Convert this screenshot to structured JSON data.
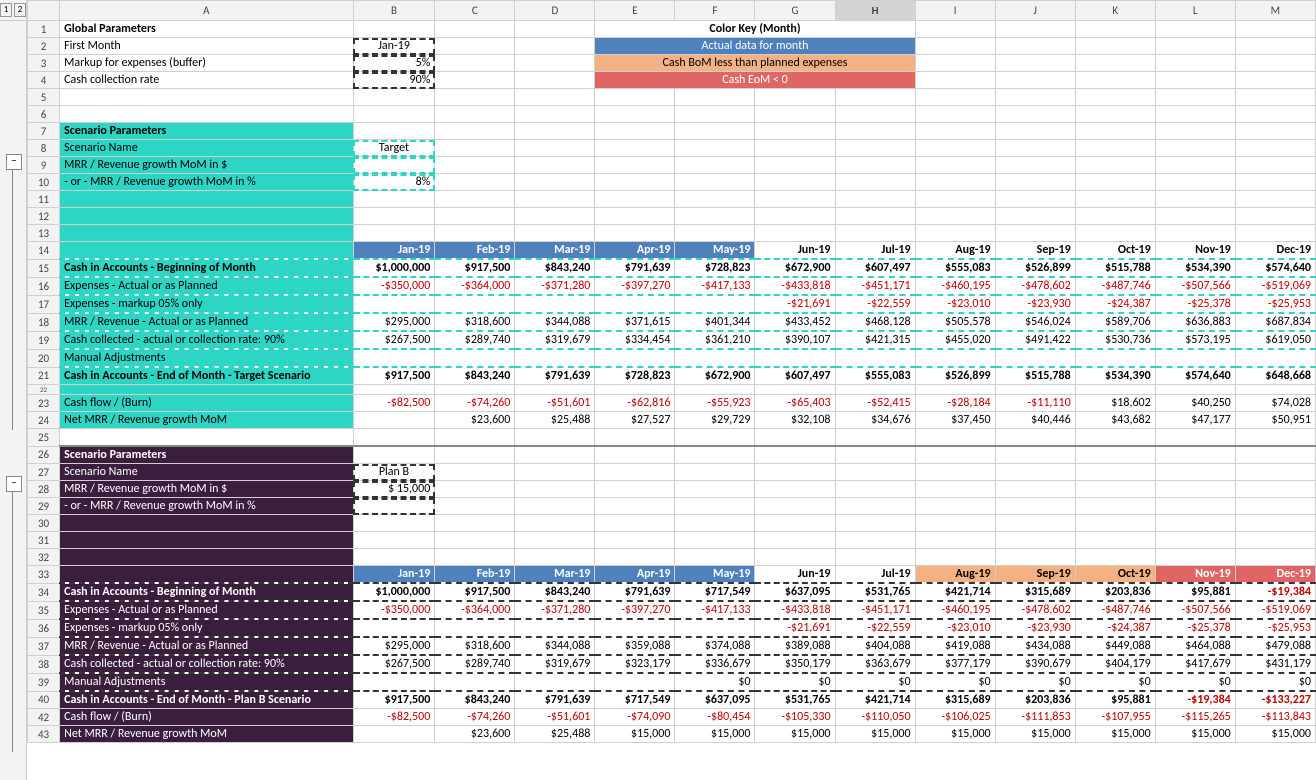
{
  "outlineLevels": [
    "1",
    "2"
  ],
  "colHeaders": [
    "A",
    "B",
    "C",
    "D",
    "E",
    "F",
    "G",
    "H",
    "I",
    "J",
    "K",
    "L",
    "M"
  ],
  "selectedCol": "H",
  "rowsVisible": [
    "1",
    "2",
    "3",
    "4",
    "5",
    "6",
    "7",
    "8",
    "9",
    "10",
    "11",
    "12",
    "13",
    "14",
    "15",
    "16",
    "17",
    "18",
    "19",
    "20",
    "21",
    "22",
    "23",
    "24",
    "25",
    "26",
    "27",
    "28",
    "29",
    "30",
    "31",
    "32",
    "33",
    "34",
    "35",
    "36",
    "37",
    "38",
    "39",
    "40",
    "42",
    "43"
  ],
  "global": {
    "title": "Global Parameters",
    "firstMonthLabel": "First Month",
    "firstMonth": "Jan-19",
    "markupLabel": "Markup for expenses (buffer)",
    "markup": "5%",
    "collectionLabel": "Cash collection rate",
    "collection": "90%"
  },
  "colorKey": {
    "title": "Color Key (Month)",
    "blue": "Actual data for month",
    "orange": "Cash BoM less than planned expenses",
    "red": "Cash EoM < 0"
  },
  "months": [
    "Jan-19",
    "Feb-19",
    "Mar-19",
    "Apr-19",
    "May-19",
    "Jun-19",
    "Jul-19",
    "Aug-19",
    "Sep-19",
    "Oct-19",
    "Nov-19",
    "Dec-19"
  ],
  "scenario1": {
    "paramTitle": "Scenario Parameters",
    "nameLabel": "Scenario Name",
    "name": "Target",
    "growthDollarLabel": "MRR / Revenue growth MoM in $",
    "growthDollar": "",
    "growthPctLabel": "- or - MRR / Revenue growth MoM in %",
    "growthPct": "8%",
    "headerClasses": [
      "hdr-blue",
      "hdr-blue",
      "hdr-blue",
      "hdr-blue",
      "hdr-blue",
      "",
      "",
      "",
      "",
      "",
      "",
      ""
    ],
    "rows": {
      "bomLabel": "Cash in Accounts - Beginning of Month",
      "bom": [
        "$1,000,000",
        "$917,500",
        "$843,240",
        "$791,639",
        "$728,823",
        "$672,900",
        "$607,497",
        "$555,083",
        "$526,899",
        "$515,788",
        "$534,390",
        "$574,640"
      ],
      "expLabel": "Expenses - Actual or as Planned",
      "exp": [
        "-$350,000",
        "-$364,000",
        "-$371,280",
        "-$397,270",
        "-$417,133",
        "-$433,818",
        "-$451,171",
        "-$460,195",
        "-$478,602",
        "-$487,746",
        "-$507,566",
        "-$519,069"
      ],
      "expMkLabel": "Expenses - markup 05% only",
      "expMk": [
        "",
        "",
        "",
        "",
        "",
        "-$21,691",
        "-$22,559",
        "-$23,010",
        "-$23,930",
        "-$24,387",
        "-$25,378",
        "-$25,953"
      ],
      "revLabel": "MRR / Revenue - Actual or as Planned",
      "rev": [
        "$295,000",
        "$318,600",
        "$344,088",
        "$371,615",
        "$401,344",
        "$433,452",
        "$468,128",
        "$505,578",
        "$546,024",
        "$589,706",
        "$636,883",
        "$687,834"
      ],
      "collLabel": "Cash collected - actual or collection rate: 90%",
      "coll": [
        "$267,500",
        "$289,740",
        "$319,679",
        "$334,454",
        "$361,210",
        "$390,107",
        "$421,315",
        "$455,020",
        "$491,422",
        "$530,736",
        "$573,195",
        "$619,050"
      ],
      "manLabel": "Manual Adjustments",
      "man": [
        "",
        "",
        "",
        "",
        "",
        "",
        "",
        "",
        "",
        "",
        "",
        ""
      ],
      "eomLabel": "Cash in Accounts - End of Month - Target Scenario",
      "eom": [
        "$917,500",
        "$843,240",
        "$791,639",
        "$728,823",
        "$672,900",
        "$607,497",
        "$555,083",
        "$526,899",
        "$515,788",
        "$534,390",
        "$574,640",
        "$648,668"
      ],
      "burnLabel": "Cash flow / (Burn)",
      "burn": [
        "-$82,500",
        "-$74,260",
        "-$51,601",
        "-$62,816",
        "-$55,923",
        "-$65,403",
        "-$52,415",
        "-$28,184",
        "-$11,110",
        "$18,602",
        "$40,250",
        "$74,028"
      ],
      "netLabel": "Net MRR / Revenue growth MoM",
      "net": [
        "",
        "$23,600",
        "$25,488",
        "$27,527",
        "$29,729",
        "$32,108",
        "$34,676",
        "$37,450",
        "$40,446",
        "$43,682",
        "$47,177",
        "$50,951"
      ]
    }
  },
  "scenario2": {
    "paramTitle": "Scenario Parameters",
    "nameLabel": "Scenario Name",
    "name": "Plan B",
    "growthDollarLabel": "MRR / Revenue growth MoM in $",
    "growthDollar": "$       15,000",
    "growthPctLabel": "- or - MRR / Revenue growth MoM in %",
    "growthPct": "",
    "headerClasses": [
      "hdr-blue",
      "hdr-blue",
      "hdr-blue",
      "hdr-blue",
      "hdr-blue",
      "",
      "",
      "hdr-orange",
      "hdr-orange",
      "hdr-orange",
      "hdr-red",
      "hdr-red"
    ],
    "rows": {
      "bomLabel": "Cash in Accounts - Beginning of Month",
      "bom": [
        "$1,000,000",
        "$917,500",
        "$843,240",
        "$791,639",
        "$717,549",
        "$637,095",
        "$531,765",
        "$421,714",
        "$315,689",
        "$203,836",
        "$95,881",
        "-$19,384"
      ],
      "expLabel": "Expenses - Actual or as Planned",
      "exp": [
        "-$350,000",
        "-$364,000",
        "-$371,280",
        "-$397,270",
        "-$417,133",
        "-$433,818",
        "-$451,171",
        "-$460,195",
        "-$478,602",
        "-$487,746",
        "-$507,566",
        "-$519,069"
      ],
      "expMkLabel": "Expenses - markup 05% only",
      "expMk": [
        "",
        "",
        "",
        "",
        "",
        "-$21,691",
        "-$22,559",
        "-$23,010",
        "-$23,930",
        "-$24,387",
        "-$25,378",
        "-$25,953"
      ],
      "revLabel": "MRR / Revenue - Actual or as Planned",
      "rev": [
        "$295,000",
        "$318,600",
        "$344,088",
        "$359,088",
        "$374,088",
        "$389,088",
        "$404,088",
        "$419,088",
        "$434,088",
        "$449,088",
        "$464,088",
        "$479,088"
      ],
      "collLabel": "Cash collected - actual or collection rate: 90%",
      "coll": [
        "$267,500",
        "$289,740",
        "$319,679",
        "$323,179",
        "$336,679",
        "$350,179",
        "$363,679",
        "$377,179",
        "$390,679",
        "$404,179",
        "$417,679",
        "$431,179"
      ],
      "manLabel": "Manual Adjustments",
      "man": [
        "",
        "",
        "",
        "",
        "$0",
        "$0",
        "$0",
        "$0",
        "$0",
        "$0",
        "$0",
        "$0"
      ],
      "eomLabel": "Cash in Accounts - End of Month - Plan B Scenario",
      "eom": [
        "$917,500",
        "$843,240",
        "$791,639",
        "$717,549",
        "$637,095",
        "$531,765",
        "$421,714",
        "$315,689",
        "$203,836",
        "$95,881",
        "-$19,384",
        "-$133,227"
      ],
      "burnLabel": "Cash flow / (Burn)",
      "burn": [
        "-$82,500",
        "-$74,260",
        "-$51,601",
        "-$74,090",
        "-$80,454",
        "-$105,330",
        "-$110,050",
        "-$106,025",
        "-$111,853",
        "-$107,955",
        "-$115,265",
        "-$113,843"
      ],
      "netLabel": "Net MRR / Revenue growth MoM",
      "net": [
        "",
        "$23,600",
        "$25,488",
        "$15,000",
        "$15,000",
        "$15,000",
        "$15,000",
        "$15,000",
        "$15,000",
        "$15,000",
        "$15,000",
        "$15,000"
      ]
    }
  }
}
